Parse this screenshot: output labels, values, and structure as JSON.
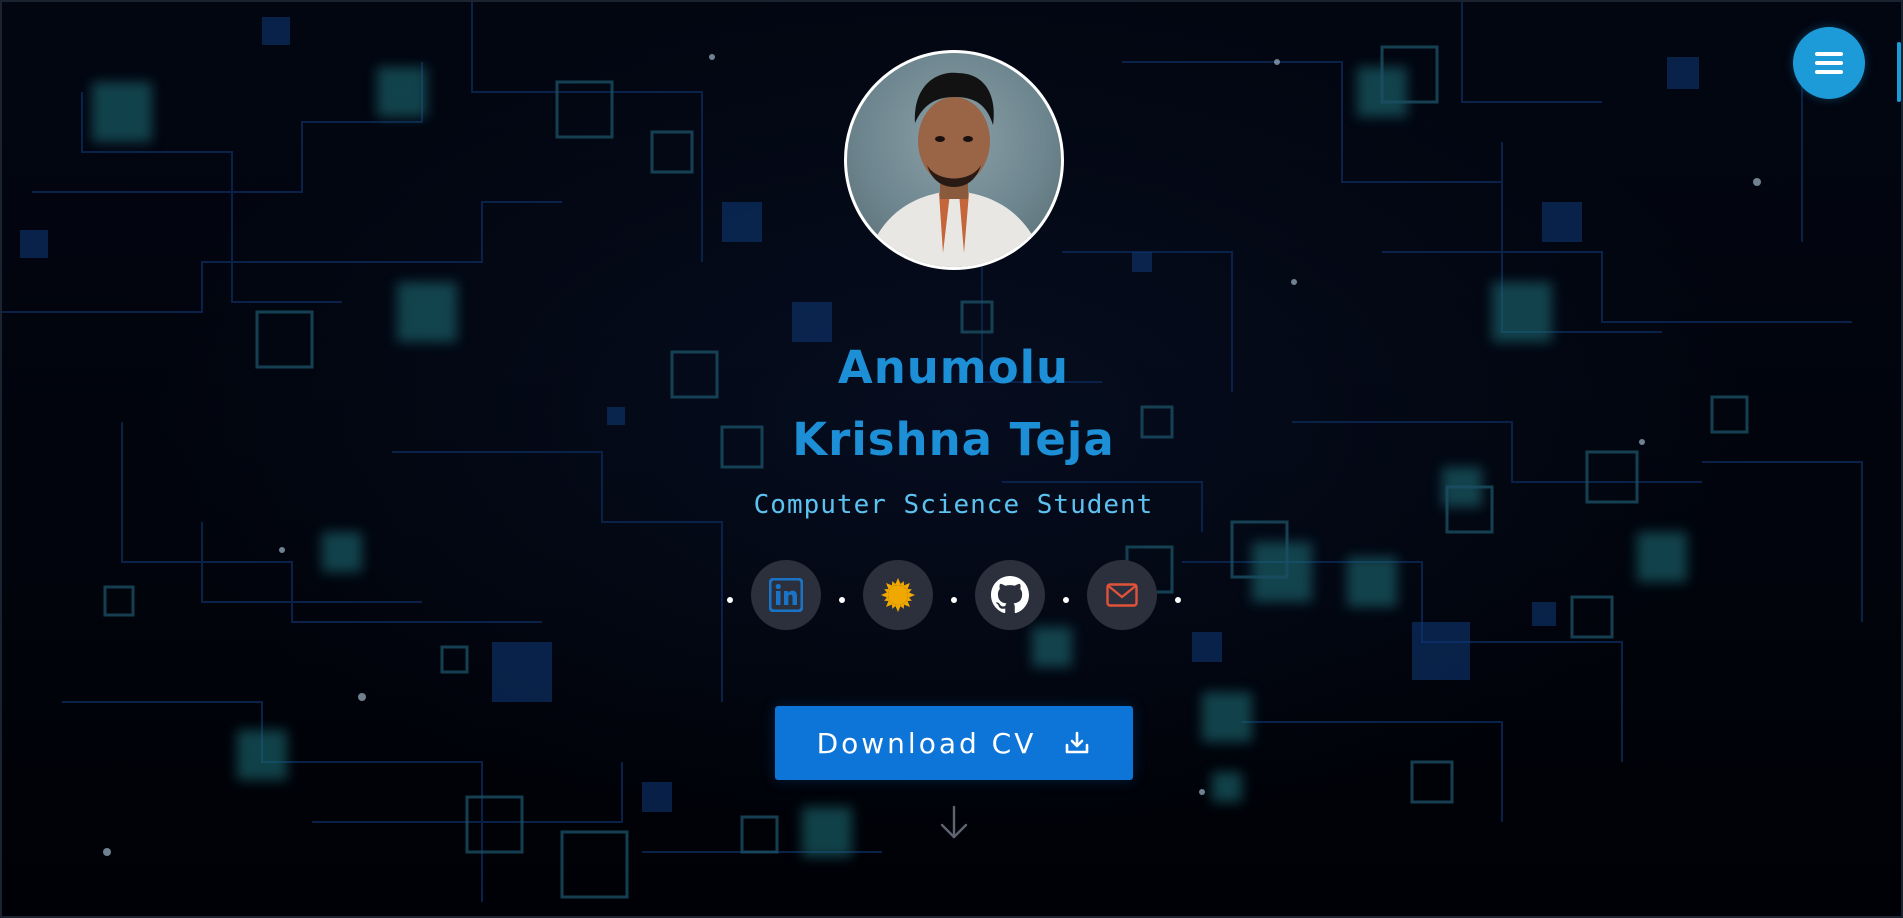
{
  "profile": {
    "first_name": "Anumolu",
    "last_name": "Krishna Teja",
    "role": "Computer Science Student"
  },
  "socials": [
    {
      "name": "LinkedIn",
      "icon": "linkedin-icon",
      "color": "#1a73c5"
    },
    {
      "name": "Sun",
      "icon": "sun-icon",
      "color": "#f0a800"
    },
    {
      "name": "GitHub",
      "icon": "github-icon",
      "color": "#ffffff"
    },
    {
      "name": "Email",
      "icon": "mail-icon",
      "color": "#e0533a"
    }
  ],
  "cta": {
    "download_label": "Download CV"
  },
  "colors": {
    "accent": "#1d8fd6",
    "button": "#0d74d8",
    "menu": "#1d9bd9",
    "background": "#01040c"
  }
}
